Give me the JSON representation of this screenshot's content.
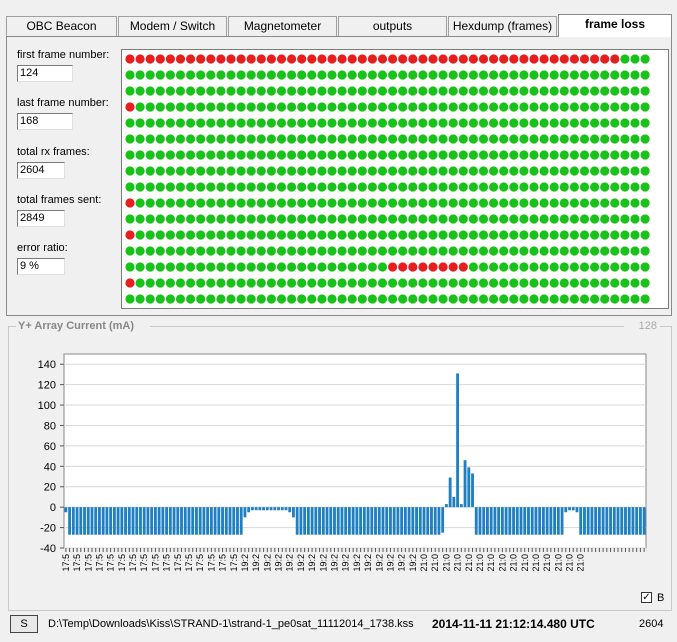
{
  "tabs": [
    {
      "label": "OBC Beacon",
      "active": false
    },
    {
      "label": "Modem / Switch",
      "active": false
    },
    {
      "label": "Magnetometer",
      "active": false
    },
    {
      "label": "outputs",
      "active": false
    },
    {
      "label": "Hexdump (frames)",
      "active": false
    },
    {
      "label": "frame loss",
      "active": true
    }
  ],
  "stats": {
    "first_frame_label": "first frame number:",
    "first_frame_value": "124",
    "last_frame_label": "last frame number:",
    "last_frame_value": "168",
    "total_rx_label": "total rx frames:",
    "total_rx_value": "2604",
    "total_sent_label": "total frames sent:",
    "total_sent_value": "2849",
    "error_ratio_label": "error ratio:",
    "error_ratio_value": "9 %"
  },
  "frame_grid": {
    "columns": 52,
    "rows": 16,
    "color_ok": "#19c219",
    "color_lost": "#e81e1e",
    "lost_cells": [
      {
        "row": 0,
        "from": 0,
        "to": 48
      },
      {
        "row": 3,
        "from": 0,
        "to": 0
      },
      {
        "row": 9,
        "from": 0,
        "to": 0
      },
      {
        "row": 14,
        "from": 0,
        "to": 0
      },
      {
        "row": 11,
        "from": 0,
        "to": 0
      },
      {
        "row": 13,
        "from": 26,
        "to": 33
      },
      {
        "row": 16,
        "from": 0,
        "to": 0
      }
    ]
  },
  "chart_panel": {
    "title": "Y+ Array Current (mA)",
    "current_value": "128"
  },
  "chart_data": {
    "type": "bar",
    "title": "Y+ Array Current (mA)",
    "ylim": [
      -40,
      150
    ],
    "yticks": [
      140,
      120,
      100,
      80,
      60,
      40,
      20,
      0,
      -20,
      -40
    ],
    "bar_color": "#1f7fc0",
    "xtick_labels": [
      "17:5",
      "17:5",
      "17:5",
      "17:5",
      "17:5",
      "17:5",
      "17:5",
      "17:5",
      "17:5",
      "17:5",
      "17:5",
      "17:5",
      "17:5",
      "17:5",
      "17:5",
      "17:5",
      "17:5",
      "17:5",
      "17:5",
      "17:5",
      "17:5",
      "17:5",
      "17:5",
      "17:5",
      "17:5",
      "17:5",
      "17:5",
      "17:5",
      "17:5",
      "17:5",
      "17:5",
      "17:5",
      "17:5",
      "17:5",
      "17:5",
      "17:5",
      "17:5",
      "17:5",
      "17:5",
      "17:5",
      "17:5",
      "17:5",
      "17:5",
      "17:5",
      "17:5",
      "17:5",
      "19:2",
      "19:2",
      "19:2",
      "19:2",
      "19:2",
      "19:2",
      "19:2",
      "19:2",
      "19:2",
      "19:2",
      "19:2",
      "19:2",
      "19:2",
      "19:2",
      "19:2",
      "19:2",
      "19:2",
      "19:2",
      "19:2",
      "19:2",
      "19:2",
      "19:2",
      "19:2",
      "19:2",
      "19:2",
      "19:2",
      "19:2",
      "19:2",
      "19:2",
      "19:2",
      "19:2",
      "19:2",
      "19:2",
      "19:2",
      "19:2",
      "19:2",
      "19:2",
      "19:2",
      "19:2",
      "19:2",
      "19:2",
      "19:2",
      "19:2",
      "19:2",
      "19:2",
      "19:2",
      "19:2",
      "19:2",
      "19:2",
      "21:0",
      "21:0",
      "21:0",
      "21:0",
      "21:0",
      "21:0",
      "21:0",
      "21:0",
      "21:0",
      "21:0",
      "21:0",
      "21:0",
      "21:0",
      "21:0",
      "21:0",
      "21:0",
      "21:0",
      "21:0",
      "21:0",
      "21:0",
      "21:0",
      "21:0",
      "21:0",
      "21:0",
      "21:0",
      "21:0",
      "21:0",
      "21:0",
      "21:0",
      "21:0",
      "21:0",
      "21:0",
      "21:0",
      "21:0",
      "21:0",
      "21:0",
      "21:0",
      "21:0",
      "21:0",
      "21:0",
      "21:0",
      "21:0",
      "21:0",
      "21:0",
      "21:0"
    ],
    "values": [
      -5,
      -27,
      -27,
      -27,
      -27,
      -27,
      -27,
      -27,
      -27,
      -27,
      -27,
      -27,
      -27,
      -27,
      -27,
      -27,
      -27,
      -27,
      -27,
      -27,
      -27,
      -27,
      -27,
      -27,
      -27,
      -27,
      -27,
      -27,
      -27,
      -27,
      -27,
      -27,
      -27,
      -27,
      -27,
      -27,
      -27,
      -27,
      -27,
      -27,
      -27,
      -27,
      -27,
      -27,
      -27,
      -27,
      -27,
      -27,
      -10,
      -5,
      -3,
      -3,
      -3,
      -3,
      -3,
      -3,
      -3,
      -3,
      -3,
      -3,
      -5,
      -10,
      -27,
      -27,
      -27,
      -27,
      -27,
      -27,
      -27,
      -27,
      -27,
      -27,
      -27,
      -27,
      -27,
      -27,
      -27,
      -27,
      -27,
      -27,
      -27,
      -27,
      -27,
      -27,
      -27,
      -27,
      -27,
      -27,
      -27,
      -27,
      -27,
      -27,
      -27,
      -27,
      -27,
      -27,
      -27,
      -27,
      -27,
      -27,
      -27,
      -25,
      3,
      29,
      10,
      131,
      3,
      46,
      39,
      33,
      -27,
      -27,
      -27,
      -27,
      -27,
      -27,
      -27,
      -27,
      -27,
      -27,
      -27,
      -27,
      -27,
      -27,
      -27,
      -27,
      -27,
      -27,
      -27,
      -27,
      -27,
      -27,
      -27,
      -27,
      -5,
      -3,
      -3,
      -5,
      -27,
      -27,
      -27,
      -27,
      -27,
      -27,
      -27,
      -27,
      -27,
      -27,
      -27,
      -27,
      -27,
      -27,
      -27,
      -27,
      -27,
      -27
    ]
  },
  "checkbox": {
    "label": "B",
    "checked": true,
    "mark": "✓"
  },
  "status": {
    "button_label": "S",
    "file_path": "D:\\Temp\\Downloads\\Kiss\\STRAND-1\\strand-1_pe0sat_11112014_1738.kss",
    "timestamp": "2014-11-11  21:12:14.480 UTC",
    "count": "2604"
  }
}
